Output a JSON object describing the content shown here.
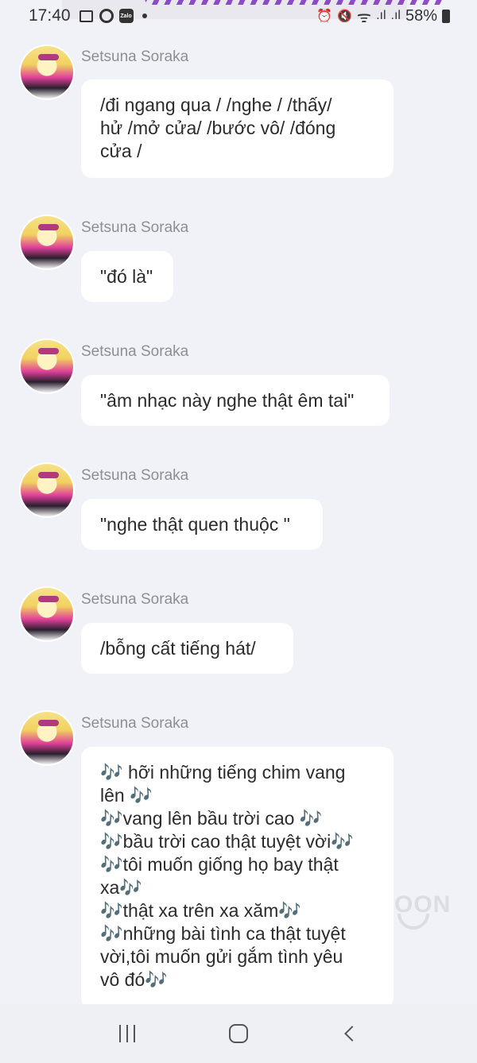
{
  "status_bar": {
    "time": "17:40",
    "left_icons": [
      "gallery-icon",
      "circle-app-icon",
      "zalo-icon",
      "dot-icon"
    ],
    "zalo_label": "Zalo",
    "right_icons": [
      "alarm-icon",
      "mute-icon",
      "wifi-icon",
      "signal-icon",
      "signal-icon",
      "battery-icon"
    ],
    "alarm_glyph": "⏰",
    "mute_glyph": "🔇",
    "wifi_glyph": "ᯤ",
    "signal_glyph": ".ıl",
    "battery": "58%"
  },
  "messages": [
    {
      "sender": "Setsuna Soraka",
      "lines": [
        "/đi ngang qua / /nghe / /thấy/",
        "hử /mở cửa/ /bước vô/ /đóng",
        "cửa /"
      ]
    },
    {
      "sender": "Setsuna Soraka",
      "lines": [
        "\"đó là\""
      ]
    },
    {
      "sender": "Setsuna Soraka",
      "lines": [
        "\"âm nhạc này nghe thật êm tai\""
      ]
    },
    {
      "sender": "Setsuna Soraka",
      "lines": [
        "\"nghe thật quen thuộc \""
      ]
    },
    {
      "sender": "Setsuna Soraka",
      "lines": [
        "/bỗng cất tiếng hát/"
      ]
    },
    {
      "sender": "Setsuna Soraka",
      "lines": [
        "🎶 hỡi những tiếng chim vang",
        "lên 🎶",
        "🎶vang lên bầu trời cao 🎶",
        "🎶bầu trời cao thật tuyệt vời🎶",
        "🎶tôi muốn giống họ bay thật",
        "xa🎶",
        "🎶thật xa trên xa xăm🎶",
        "🎶những bài tình ca thật tuyệt",
        "vời,tôi muốn gửi gắm tình yêu",
        "vô đó🎶"
      ]
    }
  ],
  "watermark": "OON",
  "nav": {
    "recents": "recents-icon",
    "home": "home-icon",
    "back": "back-icon"
  }
}
